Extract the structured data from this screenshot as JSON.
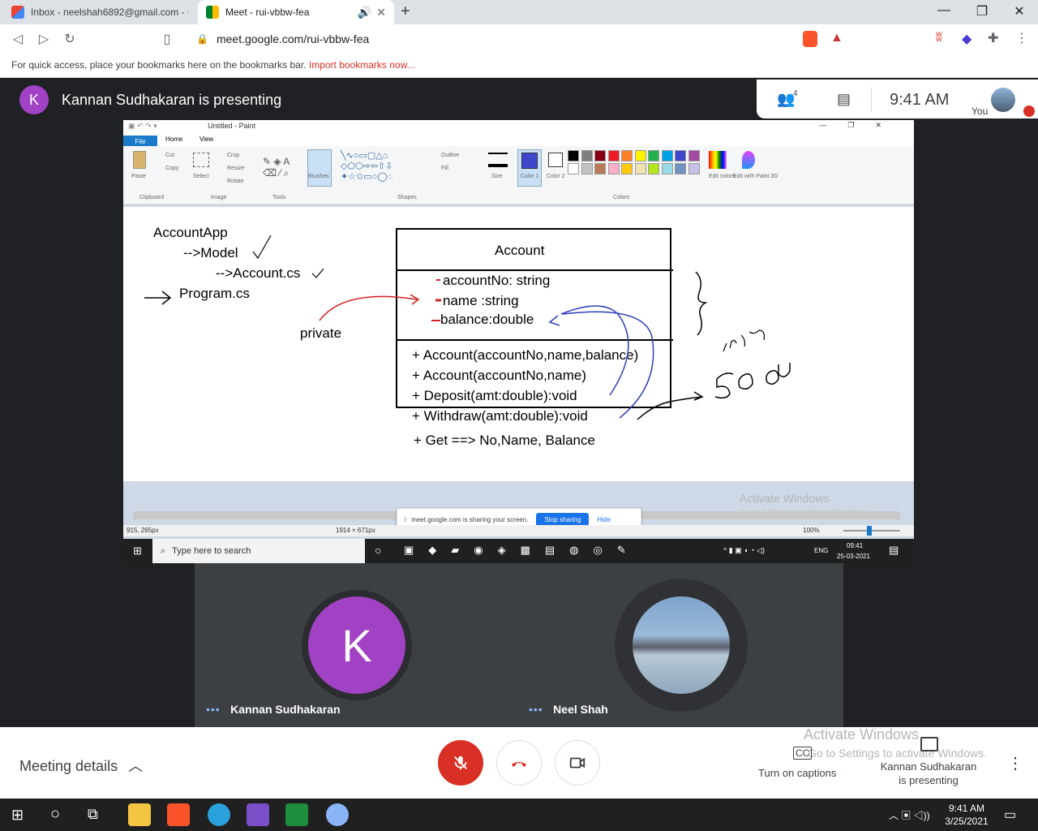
{
  "browser": {
    "tabs": [
      {
        "title": "Inbox - neelshah6892@gmail.com - G"
      },
      {
        "title": "Meet - rui-vbbw-fea"
      }
    ],
    "url": "meet.google.com/rui-vbbw-fea",
    "bookmarks_hint": "For quick access, place your bookmarks here on the bookmarks bar.",
    "import_link": "Import bookmarks now..."
  },
  "meet": {
    "presenter_initial": "K",
    "presenting_text": "Kannan Sudhakaran is presenting",
    "participant_count": "4",
    "time": "9:41  AM",
    "you_label": "You",
    "participants": [
      {
        "name": "Kannan Sudhakaran",
        "initial": "K"
      },
      {
        "name": "Neel Shah"
      }
    ],
    "meeting_details": "Meeting details",
    "captions_label": "Turn on captions",
    "present_label": "Kannan Sudhakaran is presenting",
    "activate_title": "Activate Windows",
    "activate_sub": "Go to Settings to activate Windows."
  },
  "paint": {
    "window_title": "Untitled - Paint",
    "tabs": [
      "File",
      "Home",
      "View"
    ],
    "ribbon": {
      "clipboard": "Clipboard",
      "image": "Image",
      "tools": "Tools",
      "shapes": "Shapes",
      "colors": "Colors",
      "paste": "Paste",
      "cut": "Cut",
      "copy": "Copy",
      "select": "Select",
      "crop": "Crop",
      "resize": "Resize",
      "rotate": "Rotate",
      "brushes": "Brushes",
      "outline": "Outline",
      "fill": "Fill",
      "size": "Size",
      "color1": "Color 1",
      "color2": "Color 2",
      "edit_colors": "Edit colors",
      "edit_paint3d": "Edit with Paint 3D"
    },
    "palette": [
      "#000000",
      "#7f7f7f",
      "#880015",
      "#ed1c24",
      "#ff7f27",
      "#fff200",
      "#22b14c",
      "#00a2e8",
      "#3f48cc",
      "#a349a4",
      "#ffffff",
      "#c3c3c3",
      "#b97a57",
      "#ffaec9",
      "#ffc90e",
      "#efe4b0",
      "#b5e61d",
      "#99d9ea",
      "#7092be",
      "#c8bfe7"
    ],
    "drawing": {
      "tree": [
        "AccountApp",
        "-->Model",
        "-->Account.cs",
        "Program.cs"
      ],
      "private_label": "private",
      "class_name": "Account",
      "fields": [
        "accountNo: string",
        "name :string",
        "balance:double"
      ],
      "methods": [
        "+ Account(accountNo,name,balance)",
        "+ Account(accountNo,name)",
        "+ Deposit(amt:double):void",
        "+ Withdraw(amt:double):void",
        "+ Get ==> No,Name, Balance"
      ],
      "scribble_number": "500"
    },
    "share_notice": "meet.google.com is sharing your screen.",
    "stop_sharing": "Stop sharing",
    "hide": "Hide",
    "activate_title": "Activate Windows",
    "activate_sub": "Go to Settings to activate Windows.",
    "status_cursor": "915, 265px",
    "status_size": "1914 × 671px",
    "zoom": "100%",
    "task_search": "Type here to search",
    "task_time": "09:41",
    "task_date": "25-03-2021",
    "task_lang": "ENG"
  },
  "taskbar": {
    "time": "9:41 AM",
    "date": "3/25/2021"
  },
  "colors": {
    "presenter_purple": "#a142c4",
    "mic_red": "#d93025",
    "meet_dark": "#202124"
  }
}
